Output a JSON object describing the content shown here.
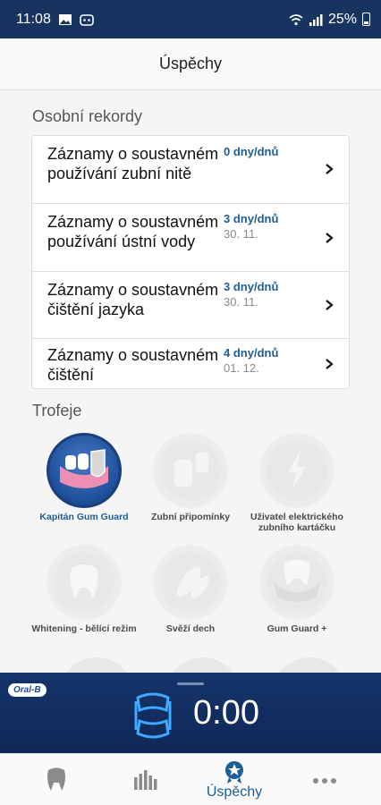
{
  "status_bar": {
    "time": "11:08",
    "battery": "25%"
  },
  "header": {
    "title": "Úspěchy"
  },
  "records": {
    "section_title": "Osobní rekordy",
    "items": [
      {
        "title": "Záznamy o soustavném používání zubní nitě",
        "days": "0 dny/dnů",
        "date": ""
      },
      {
        "title": "Záznamy o soustavném používání ústní vody",
        "days": "3 dny/dnů",
        "date": "30. 11."
      },
      {
        "title": "Záznamy o soustavném čištění jazyka",
        "days": "3 dny/dnů",
        "date": "30. 11."
      },
      {
        "title": "Záznamy o soustavném čištění",
        "days": "4 dny/dnů",
        "date": "01. 12."
      }
    ]
  },
  "trophies": {
    "section_title": "Trofeje",
    "items": [
      {
        "label": "Kapitán Gum Guard",
        "active": true
      },
      {
        "label": "Zubní připomínky",
        "active": false
      },
      {
        "label": "Uživatel elektrického zubního kartáčku",
        "active": false
      },
      {
        "label": "Whitening - bělící režim",
        "active": false
      },
      {
        "label": "Svěží dech",
        "active": false
      },
      {
        "label": "Gum Guard +",
        "active": false
      }
    ]
  },
  "player": {
    "brand": "Oral-B",
    "timer": "0:00"
  },
  "tabbar": {
    "active_tab_label": "Úspěchy"
  },
  "colors": {
    "accent": "#1d5e95",
    "navy": "#16345f"
  }
}
